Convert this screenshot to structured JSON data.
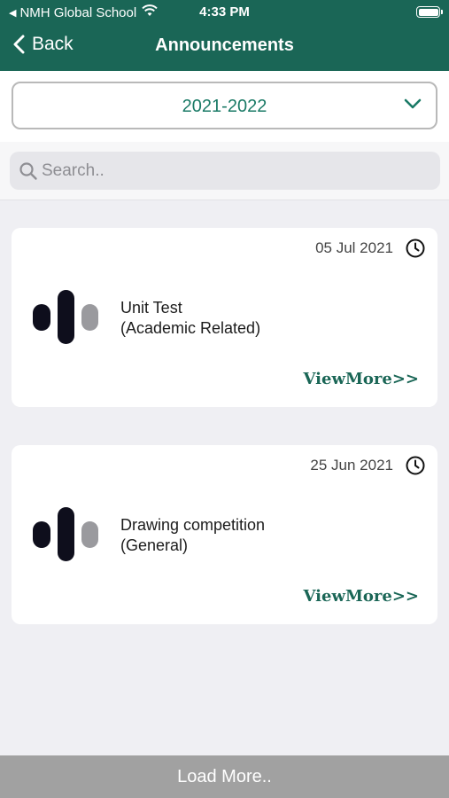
{
  "status_bar": {
    "carrier": "NMH Global School",
    "time": "4:33 PM"
  },
  "nav": {
    "back_label": "Back",
    "title": "Announcements"
  },
  "year_selector": {
    "selected": "2021-2022"
  },
  "search": {
    "placeholder": "Search.."
  },
  "announcements": [
    {
      "date": "05 Jul 2021",
      "title": "Unit Test",
      "category": "(Academic Related)",
      "view_more": "ViewMore>>"
    },
    {
      "date": "25 Jun 2021",
      "title": "Drawing competition",
      "category": "(General)",
      "view_more": "ViewMore>>"
    }
  ],
  "load_more_label": "Load More..",
  "colors": {
    "header_green": "#1a6656",
    "accent_teal": "#1a7a66",
    "load_more_gray": "#a1a1a1"
  }
}
